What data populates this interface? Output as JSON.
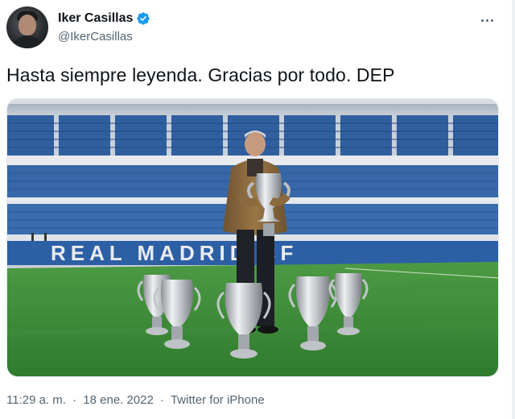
{
  "author": {
    "display_name": "Iker Casillas",
    "handle": "@IkerCasillas",
    "verified": true
  },
  "tweet": {
    "text": "Hasta siempre leyenda. Gracias por todo. DEP"
  },
  "media": {
    "stadium_lettering": "REAL MADRID CF",
    "trophy_count": 6
  },
  "meta": {
    "time": "11:29 a. m.",
    "separator": "·",
    "date": "18 ene. 2022",
    "source": "Twitter for iPhone"
  },
  "colors": {
    "text_primary": "#0f1419",
    "text_secondary": "#536471",
    "verified_blue": "#1d9bf0",
    "pitch_green": "#3f8f3a",
    "seat_blue": "#2f5f9e"
  },
  "icons": {
    "verified": "verified-badge-icon",
    "more": "more-options-icon"
  }
}
